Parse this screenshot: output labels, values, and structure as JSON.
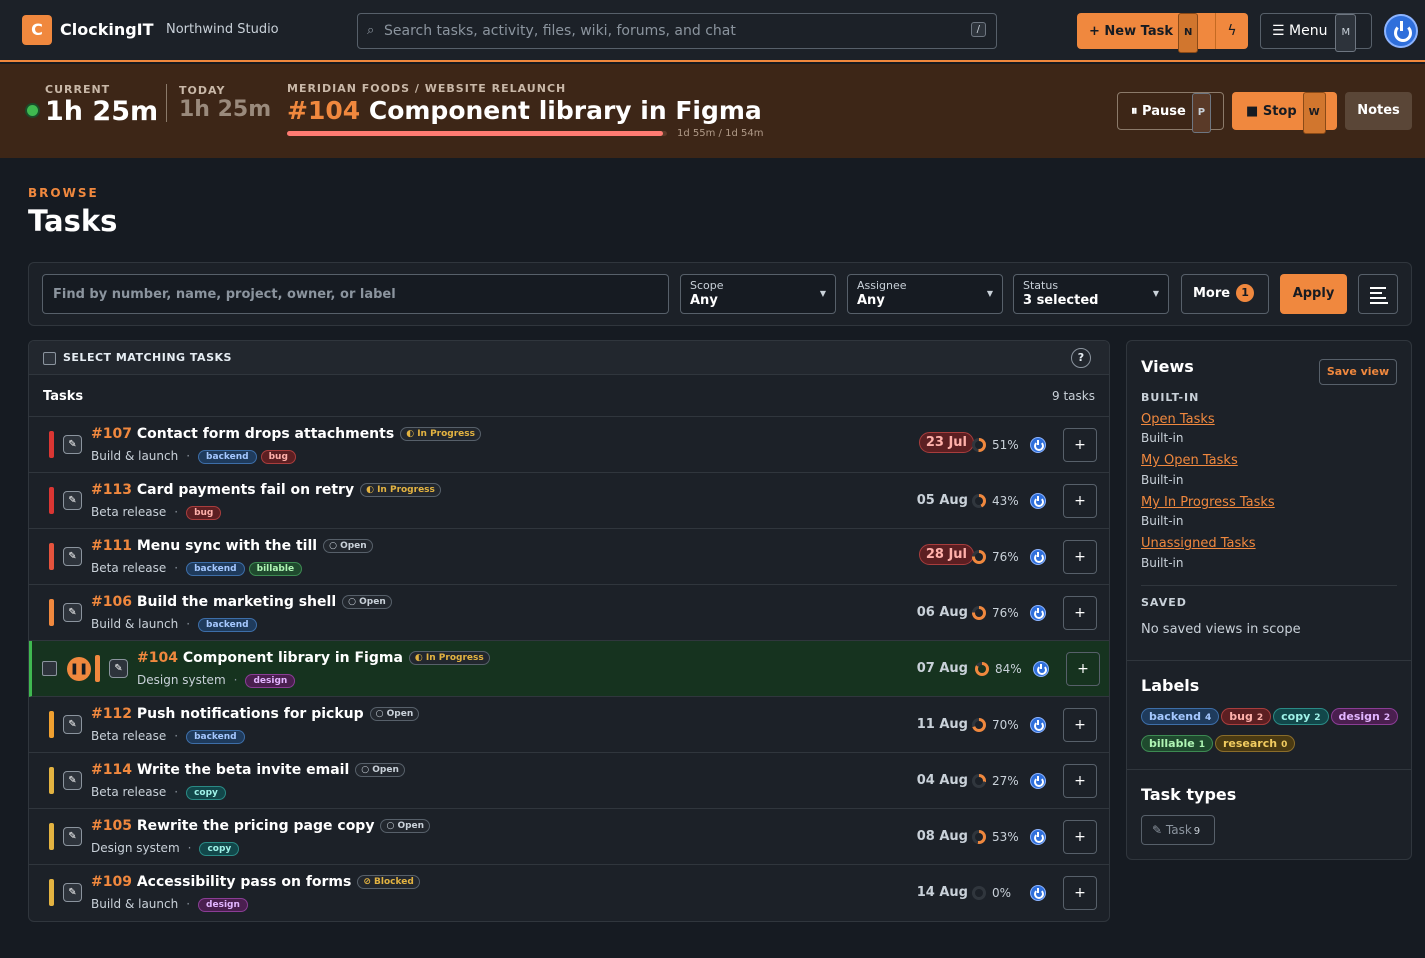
{
  "app": {
    "logo_letter": "C",
    "name": "ClockingIT",
    "org": "Northwind Studio"
  },
  "search": {
    "placeholder": "Search tasks, activity, files, wiki, forums, and chat",
    "shortcut": "/"
  },
  "header": {
    "new_task": "+ New Task",
    "new_task_key": "N",
    "bolt_icon": "bolt-icon",
    "menu": "Menu",
    "menu_key": "M",
    "menu_icon": "hamburger-icon",
    "user_icon": "power-icon"
  },
  "timer": {
    "current_label": "CURRENT",
    "current_value": "1h 25m",
    "today_label": "TODAY",
    "today_value": "1h 25m",
    "breadcrumb": "MERIDIAN FOODS / WEBSITE RELAUNCH",
    "task_num": "#104",
    "task_name": "Component library in Figma",
    "progress": 0.99,
    "progress_text": "1d 55m / 1d 54m",
    "pause": "Pause",
    "pause_key": "P",
    "pause_icon": "⏸",
    "stop": "Stop",
    "stop_key": "W",
    "stop_icon": "■",
    "notes": "Notes"
  },
  "page": {
    "eyebrow": "BROWSE",
    "title": "Tasks"
  },
  "filters": {
    "find_placeholder": "Find by number, name, project, owner, or label",
    "scope_label": "Scope",
    "scope_value": "Any",
    "assignee_label": "Assignee",
    "assignee_value": "Any",
    "status_label": "Status",
    "status_value": "3 selected",
    "more": "More",
    "more_count": "1",
    "apply": "Apply"
  },
  "table": {
    "select_all": "SELECT MATCHING TASKS",
    "help": "?",
    "heading": "Tasks",
    "count": "9 tasks",
    "rows": [
      {
        "num": "#107",
        "name": "Contact form drops attachments",
        "status": "In Progress",
        "status_icon": "◐",
        "status_class": "inprog",
        "project": "Build & launch",
        "labels": [
          "backend",
          "bug"
        ],
        "due": "23 Jul",
        "overdue": true,
        "pct": 51,
        "pct_text": "51%",
        "priority_color": "#da3633"
      },
      {
        "num": "#113",
        "name": "Card payments fail on retry",
        "status": "In Progress",
        "status_icon": "◐",
        "status_class": "inprog",
        "project": "Beta release",
        "labels": [
          "bug"
        ],
        "due": "05 Aug",
        "overdue": false,
        "pct": 43,
        "pct_text": "43%",
        "priority_color": "#da3633"
      },
      {
        "num": "#111",
        "name": "Menu sync with the till",
        "status": "Open",
        "status_icon": "○",
        "status_class": "open",
        "project": "Beta release",
        "labels": [
          "backend",
          "billable"
        ],
        "due": "28 Jul",
        "overdue": true,
        "pct": 76,
        "pct_text": "76%",
        "priority_color": "#e5533d"
      },
      {
        "num": "#106",
        "name": "Build the marketing shell",
        "status": "Open",
        "status_icon": "○",
        "status_class": "open",
        "project": "Build & launch",
        "labels": [
          "backend"
        ],
        "due": "06 Aug",
        "overdue": false,
        "pct": 76,
        "pct_text": "76%",
        "priority_color": "#f0883e"
      },
      {
        "num": "#104",
        "name": "Component library in Figma",
        "status": "In Progress",
        "status_icon": "◐",
        "status_class": "inprog",
        "project": "Design system",
        "labels": [
          "design"
        ],
        "due": "07 Aug",
        "overdue": false,
        "pct": 84,
        "pct_text": "84%",
        "priority_color": "#f0883e",
        "active": true
      },
      {
        "num": "#112",
        "name": "Push notifications for pickup",
        "status": "Open",
        "status_icon": "○",
        "status_class": "open",
        "project": "Beta release",
        "labels": [
          "backend"
        ],
        "due": "11 Aug",
        "overdue": false,
        "pct": 70,
        "pct_text": "70%",
        "priority_color": "#f0a030"
      },
      {
        "num": "#114",
        "name": "Write the beta invite email",
        "status": "Open",
        "status_icon": "○",
        "status_class": "open",
        "project": "Beta release",
        "labels": [
          "copy"
        ],
        "due": "04 Aug",
        "overdue": false,
        "pct": 27,
        "pct_text": "27%",
        "priority_color": "#e3b341"
      },
      {
        "num": "#105",
        "name": "Rewrite the pricing page copy",
        "status": "Open",
        "status_icon": "○",
        "status_class": "open",
        "project": "Design system",
        "labels": [
          "copy"
        ],
        "due": "08 Aug",
        "overdue": false,
        "pct": 53,
        "pct_text": "53%",
        "priority_color": "#e3b341"
      },
      {
        "num": "#109",
        "name": "Accessibility pass on forms",
        "status": "Blocked",
        "status_icon": "⊘",
        "status_class": "blocked",
        "project": "Build & launch",
        "labels": [
          "design"
        ],
        "due": "14 Aug",
        "overdue": false,
        "pct": 0,
        "pct_text": "0%",
        "priority_color": "#e3b341"
      }
    ]
  },
  "sidebar": {
    "views_title": "Views",
    "save_view": "Save view",
    "builtin_label": "BUILT-IN",
    "views": [
      {
        "name": "Open Tasks",
        "sub": "Built-in"
      },
      {
        "name": "My Open Tasks",
        "sub": "Built-in"
      },
      {
        "name": "My In Progress Tasks",
        "sub": "Built-in"
      },
      {
        "name": "Unassigned Tasks",
        "sub": "Built-in"
      }
    ],
    "saved_label": "SAVED",
    "saved_empty": "No saved views in scope",
    "labels_title": "Labels",
    "labels": [
      {
        "name": "backend",
        "count": "4"
      },
      {
        "name": "bug",
        "count": "2"
      },
      {
        "name": "copy",
        "count": "2"
      },
      {
        "name": "design",
        "count": "2"
      },
      {
        "name": "billable",
        "count": "1"
      },
      {
        "name": "research",
        "count": "0"
      }
    ],
    "types_title": "Task types",
    "types": [
      {
        "name": "Task",
        "count": "9",
        "icon": "pencil-icon"
      }
    ]
  },
  "colors": {
    "accent": "#f0883e",
    "timer_bg": "#3d2617",
    "page_bg": "#161b22",
    "active_row": "#16331f",
    "progress": "#ff7b72",
    "ring_fill": "#f0883e",
    "ring_track": "#30363d"
  }
}
